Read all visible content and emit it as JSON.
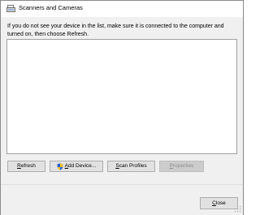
{
  "window": {
    "title": "Scanners and Cameras"
  },
  "instructions": "If you do not see your device in the list, make sure it is connected to the computer and turned on, then choose Refresh.",
  "buttons": {
    "refresh": {
      "mnemonic": "R",
      "rest": "efresh"
    },
    "add_device": {
      "mnemonic": "A",
      "rest": "dd Device..."
    },
    "scan_profiles": {
      "mnemonic": "S",
      "rest": "can Profiles"
    },
    "properties": {
      "mnemonic": "P",
      "rest": "roperties"
    },
    "close": {
      "mnemonic": "C",
      "rest": "lose"
    }
  },
  "icons": {
    "title": "scanner-icon",
    "add_device": "uac-shield-icon",
    "grip": "resize-grip-icon"
  }
}
